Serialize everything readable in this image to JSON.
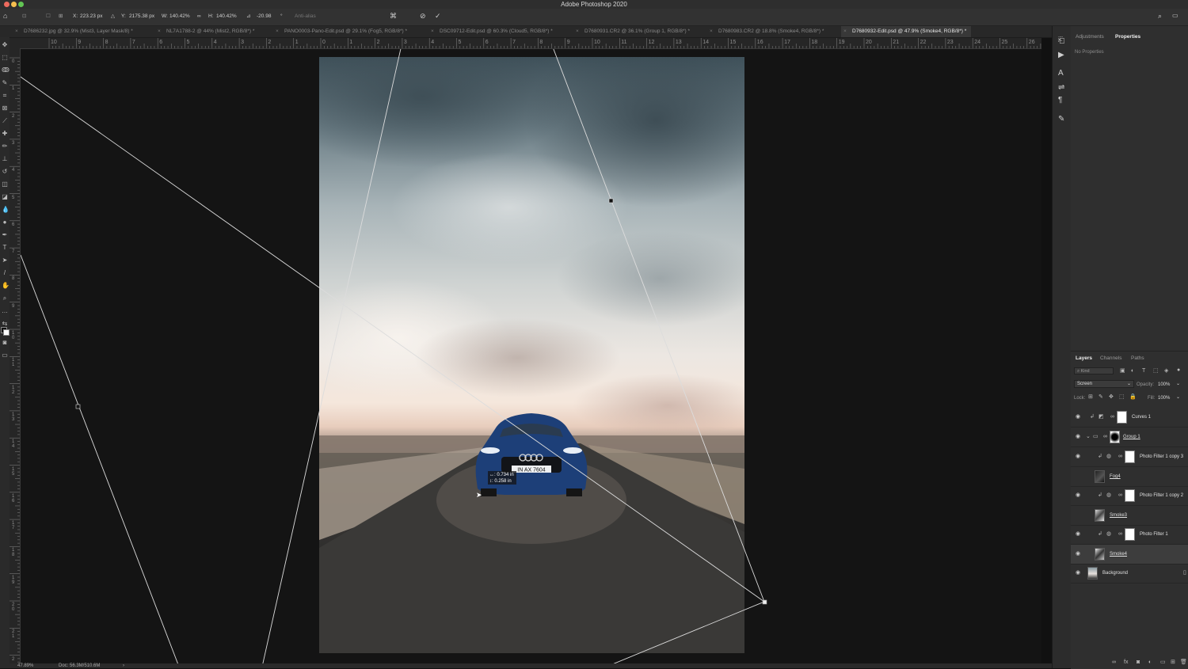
{
  "app": {
    "title": "Adobe Photoshop 2020"
  },
  "options": {
    "x_label": "X:",
    "x_value": "223.23 px",
    "y_label": "Y:",
    "y_value": "2175.38 px",
    "w_label": "W:",
    "w_value": "140.42%",
    "h_label": "H:",
    "h_value": "140.42%",
    "angle_value": "-20.98",
    "deg": "°",
    "antialias_label": "Anti-alias"
  },
  "tabs": [
    {
      "label": "D7686232.jpg @ 32.9% (Mist3, Layer Mask/8) *"
    },
    {
      "label": "NL7A1788-2 @ 44% (Mist2, RGB/8*) *"
    },
    {
      "label": "PANO0003-Pano-Edit.psd @ 29.1% (Fog5, RGB/8*) *"
    },
    {
      "label": "DSC09712-Edit.psd @ 60.3% (Cloud5, RGB/8*) *"
    },
    {
      "label": "D7680931.CR2 @ 36.1% (Group 1, RGB/8*) *"
    },
    {
      "label": "D7680983.CR2 @ 18.8% (Smoke4, RGB/8*) *"
    },
    {
      "label": "D7680932-Edit.psd @ 47.9% (Smoke4, RGB/8*) *"
    }
  ],
  "ruler": {
    "top": [
      "10",
      "9",
      "8",
      "7",
      "6",
      "5",
      "4",
      "3",
      "2",
      "1",
      "0",
      "1",
      "2",
      "3",
      "4",
      "5",
      "6",
      "7",
      "8",
      "9",
      "10",
      "11",
      "12",
      "13",
      "14",
      "15",
      "16",
      "17",
      "18",
      "19",
      "20",
      "21",
      "22",
      "23",
      "24",
      "25",
      "26"
    ],
    "left": [
      "0",
      "1",
      "2",
      "3",
      "4",
      "5",
      "6",
      "7",
      "8",
      "9",
      "1 0",
      "1 1",
      "1 2",
      "1 3",
      "1 4",
      "1 5",
      "1 6",
      "1 7",
      "1 8",
      "1 9",
      "2 0",
      "2 1",
      "2"
    ]
  },
  "canvas": {
    "tooltip_line1": "↔: 0.734 in",
    "tooltip_line2": "↕: 0.258 in",
    "plate": "IN AX 7604"
  },
  "status": {
    "zoom": "47.89%",
    "doc": "Doc: 56.3M/510.6M"
  },
  "panel_top": {
    "tab1": "Adjustments",
    "tab2": "Properties",
    "empty": "No Properties"
  },
  "layers_panel": {
    "tab1": "Layers",
    "tab2": "Channels",
    "tab3": "Paths",
    "kind_placeholder": "Kind",
    "blend_mode": "Screen",
    "opacity_label": "Opacity:",
    "opacity_value": "100%",
    "lock_label": "Lock:",
    "fill_label": "Fill:",
    "fill_value": "100%",
    "layers": [
      {
        "name": "Curves 1"
      },
      {
        "name": "Group 1"
      },
      {
        "name": "Photo Filter 1 copy 3"
      },
      {
        "name": "Fog4"
      },
      {
        "name": "Photo Filter 1 copy 2"
      },
      {
        "name": "Smoke3"
      },
      {
        "name": "Photo Filter 1"
      },
      {
        "name": "Smoke4"
      },
      {
        "name": "Background"
      }
    ]
  }
}
